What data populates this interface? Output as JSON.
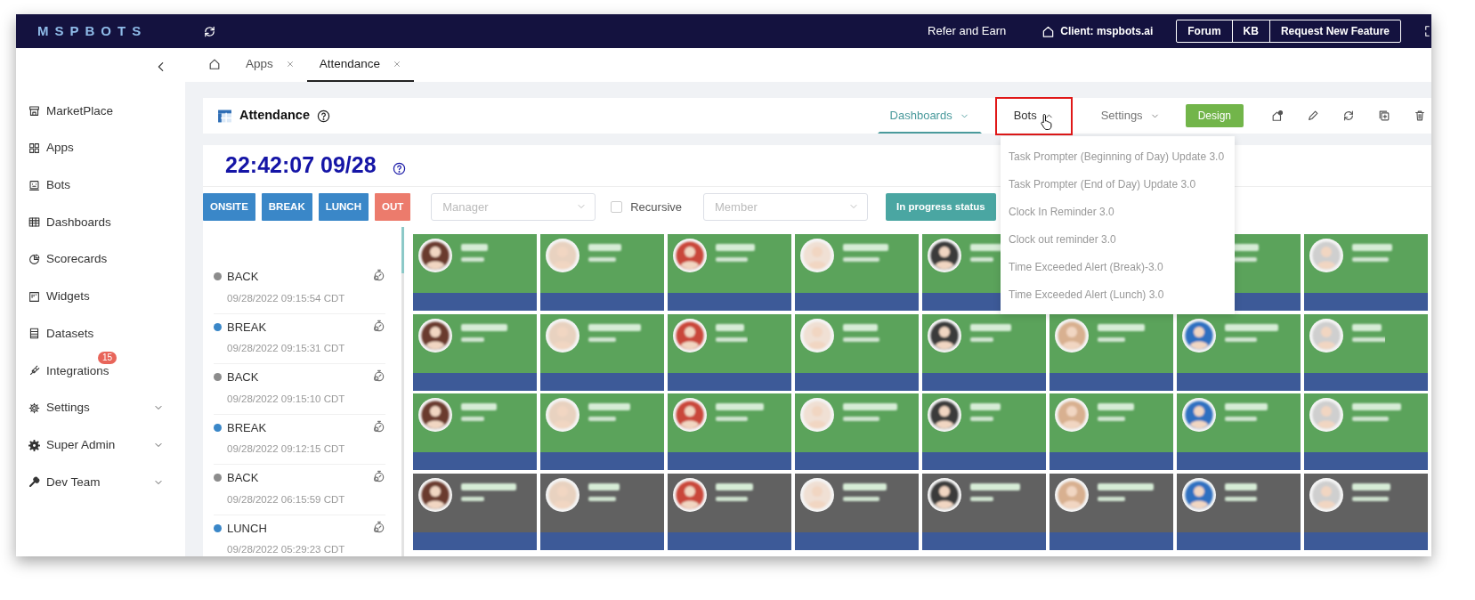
{
  "top_bar": {
    "logo": "MSPBOTS",
    "refer_link": "Refer and Earn",
    "client": "Client: mspbots.ai",
    "buttons": [
      "Forum",
      "KB",
      "Request New Feature"
    ]
  },
  "sidebar": {
    "items": [
      {
        "label": "MarketPlace",
        "has_submenu": false
      },
      {
        "label": "Apps",
        "has_submenu": false
      },
      {
        "label": "Bots",
        "has_submenu": false
      },
      {
        "label": "Dashboards",
        "has_submenu": false
      },
      {
        "label": "Scorecards",
        "has_submenu": false
      },
      {
        "label": "Widgets",
        "has_submenu": false
      },
      {
        "label": "Datasets",
        "has_submenu": false
      },
      {
        "label": "Integrations",
        "has_submenu": false,
        "badge": "15"
      },
      {
        "label": "Settings",
        "has_submenu": true
      },
      {
        "label": "Super Admin",
        "has_submenu": true
      },
      {
        "label": "Dev Team",
        "has_submenu": true
      }
    ]
  },
  "tabs": [
    {
      "kind": "home",
      "selected": false,
      "closable": false
    },
    {
      "kind": "page",
      "label": "Apps",
      "selected": false,
      "closable": true
    },
    {
      "kind": "page",
      "label": "Attendance",
      "selected": true,
      "closable": true
    }
  ],
  "header": {
    "title": "Attendance",
    "menus": [
      {
        "label": "Dashboards",
        "selected": true,
        "open": false,
        "highlighted": false
      },
      {
        "label": "Bots",
        "selected": false,
        "open": true,
        "highlighted": true,
        "items": [
          "Task Prompter (Beginning of Day) Update 3.0",
          "Task Prompter (End of Day) Update 3.0",
          "Clock In Reminder 3.0",
          "Clock out reminder 3.0",
          "Time Exceeded Alert (Break)-3.0",
          "Time Exceeded Alert (Lunch) 3.0"
        ]
      },
      {
        "label": "Settings",
        "selected": false,
        "open": false,
        "highlighted": false
      }
    ],
    "design_button": "Design"
  },
  "clock": "22:42:07 09/28",
  "filters": {
    "status_buttons": [
      {
        "label": "ONSITE",
        "color": "#3a87c8"
      },
      {
        "label": "BREAK",
        "color": "#3a87c8"
      },
      {
        "label": "LUNCH",
        "color": "#3a87c8"
      },
      {
        "label": "OUT",
        "color": "#ec7b6c"
      }
    ],
    "manager": {
      "placeholder": "Manager"
    },
    "recursive": {
      "label": "Recursive",
      "checked": false
    },
    "member": {
      "placeholder": "Member"
    },
    "progress_button": "In progress status"
  },
  "events": [
    {
      "label": "BACK",
      "time": "09/28/2022 09:15:54 CDT",
      "color": "#8c8c8c"
    },
    {
      "label": "BREAK",
      "time": "09/28/2022 09:15:31 CDT",
      "color": "#3a87c8"
    },
    {
      "label": "BACK",
      "time": "09/28/2022 09:15:10 CDT",
      "color": "#8c8c8c"
    },
    {
      "label": "BREAK",
      "time": "09/28/2022 09:12:15 CDT",
      "color": "#3a87c8"
    },
    {
      "label": "BACK",
      "time": "09/28/2022 06:15:59 CDT",
      "color": "#8c8c8c"
    },
    {
      "label": "LUNCH",
      "time": "09/28/2022 05:29:23 CDT",
      "color": "#3a87c8"
    }
  ],
  "card_rows": [
    [
      {
        "color": "#5ba35b"
      },
      {
        "color": "#5ba35b"
      },
      {
        "color": "#5ba35b"
      },
      {
        "color": "#5ba35b"
      },
      {
        "color": "#5ba35b"
      },
      null,
      {
        "color": "#5ba35b",
        "avatar": false
      },
      {
        "color": "#5ba35b"
      }
    ],
    [
      {
        "color": "#5ba35b"
      },
      {
        "color": "#5ba35b"
      },
      {
        "color": "#5ba35b"
      },
      {
        "color": "#5ba35b"
      },
      {
        "color": "#5ba35b"
      },
      {
        "color": "#5ba35b"
      },
      {
        "color": "#5ba35b"
      },
      {
        "color": "#5ba35b"
      }
    ],
    [
      {
        "color": "#5ba35b"
      },
      {
        "color": "#5ba35b"
      },
      {
        "color": "#5ba35b"
      },
      {
        "color": "#5ba35b"
      },
      {
        "color": "#5ba35b"
      },
      {
        "color": "#5ba35b"
      },
      {
        "color": "#5ba35b"
      },
      {
        "color": "#5ba35b"
      }
    ],
    [
      {
        "color": "#616161"
      },
      {
        "color": "#616161"
      },
      {
        "color": "#616161"
      },
      {
        "color": "#616161"
      },
      {
        "color": "#616161"
      },
      {
        "color": "#616161"
      },
      {
        "color": "#616161"
      },
      {
        "color": "#616161"
      }
    ]
  ]
}
